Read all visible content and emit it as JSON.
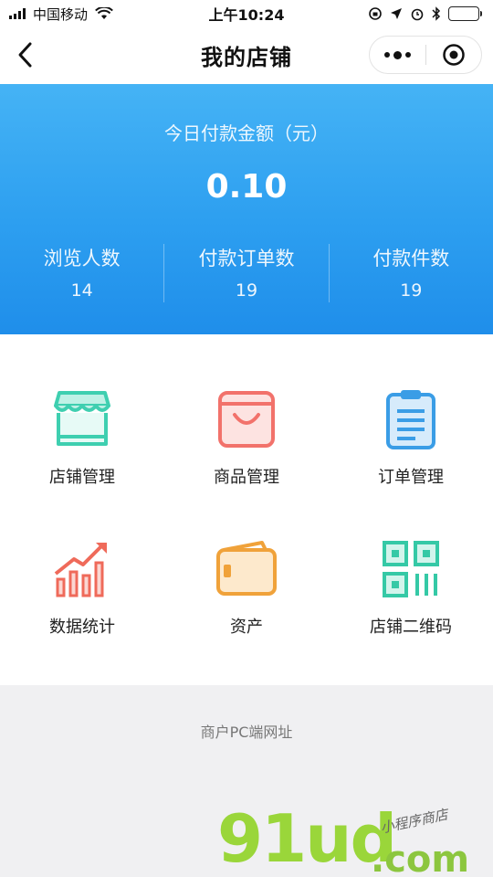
{
  "status_bar": {
    "carrier": "中国移动",
    "time": "上午10:24"
  },
  "nav": {
    "title": "我的店铺"
  },
  "stats": {
    "caption": "今日付款金额（元）",
    "amount": "0.10",
    "items": [
      {
        "label": "浏览人数",
        "value": "14"
      },
      {
        "label": "付款订单数",
        "value": "19"
      },
      {
        "label": "付款件数",
        "value": "19"
      }
    ]
  },
  "menu": [
    {
      "label": "店铺管理",
      "icon": "store-icon",
      "color": "#3ecfb0"
    },
    {
      "label": "商品管理",
      "icon": "shopping-bag-icon",
      "color": "#f2726b"
    },
    {
      "label": "订单管理",
      "icon": "clipboard-icon",
      "color": "#3a9de6"
    },
    {
      "label": "数据统计",
      "icon": "bar-chart-icon",
      "color": "#ef6a5a"
    },
    {
      "label": "资产",
      "icon": "wallet-icon",
      "color": "#f0a23a"
    },
    {
      "label": "店铺二维码",
      "icon": "qr-code-icon",
      "color": "#35c9a6"
    }
  ],
  "footer": {
    "pc_link": "商户PC端网址"
  },
  "watermark": {
    "brand": "91ud",
    "domain": ".com",
    "tagline": "小程序商店"
  },
  "colors": {
    "panel_top": "#45b3f5",
    "panel_bottom": "#1f8eea",
    "battery": "#4cd964"
  }
}
